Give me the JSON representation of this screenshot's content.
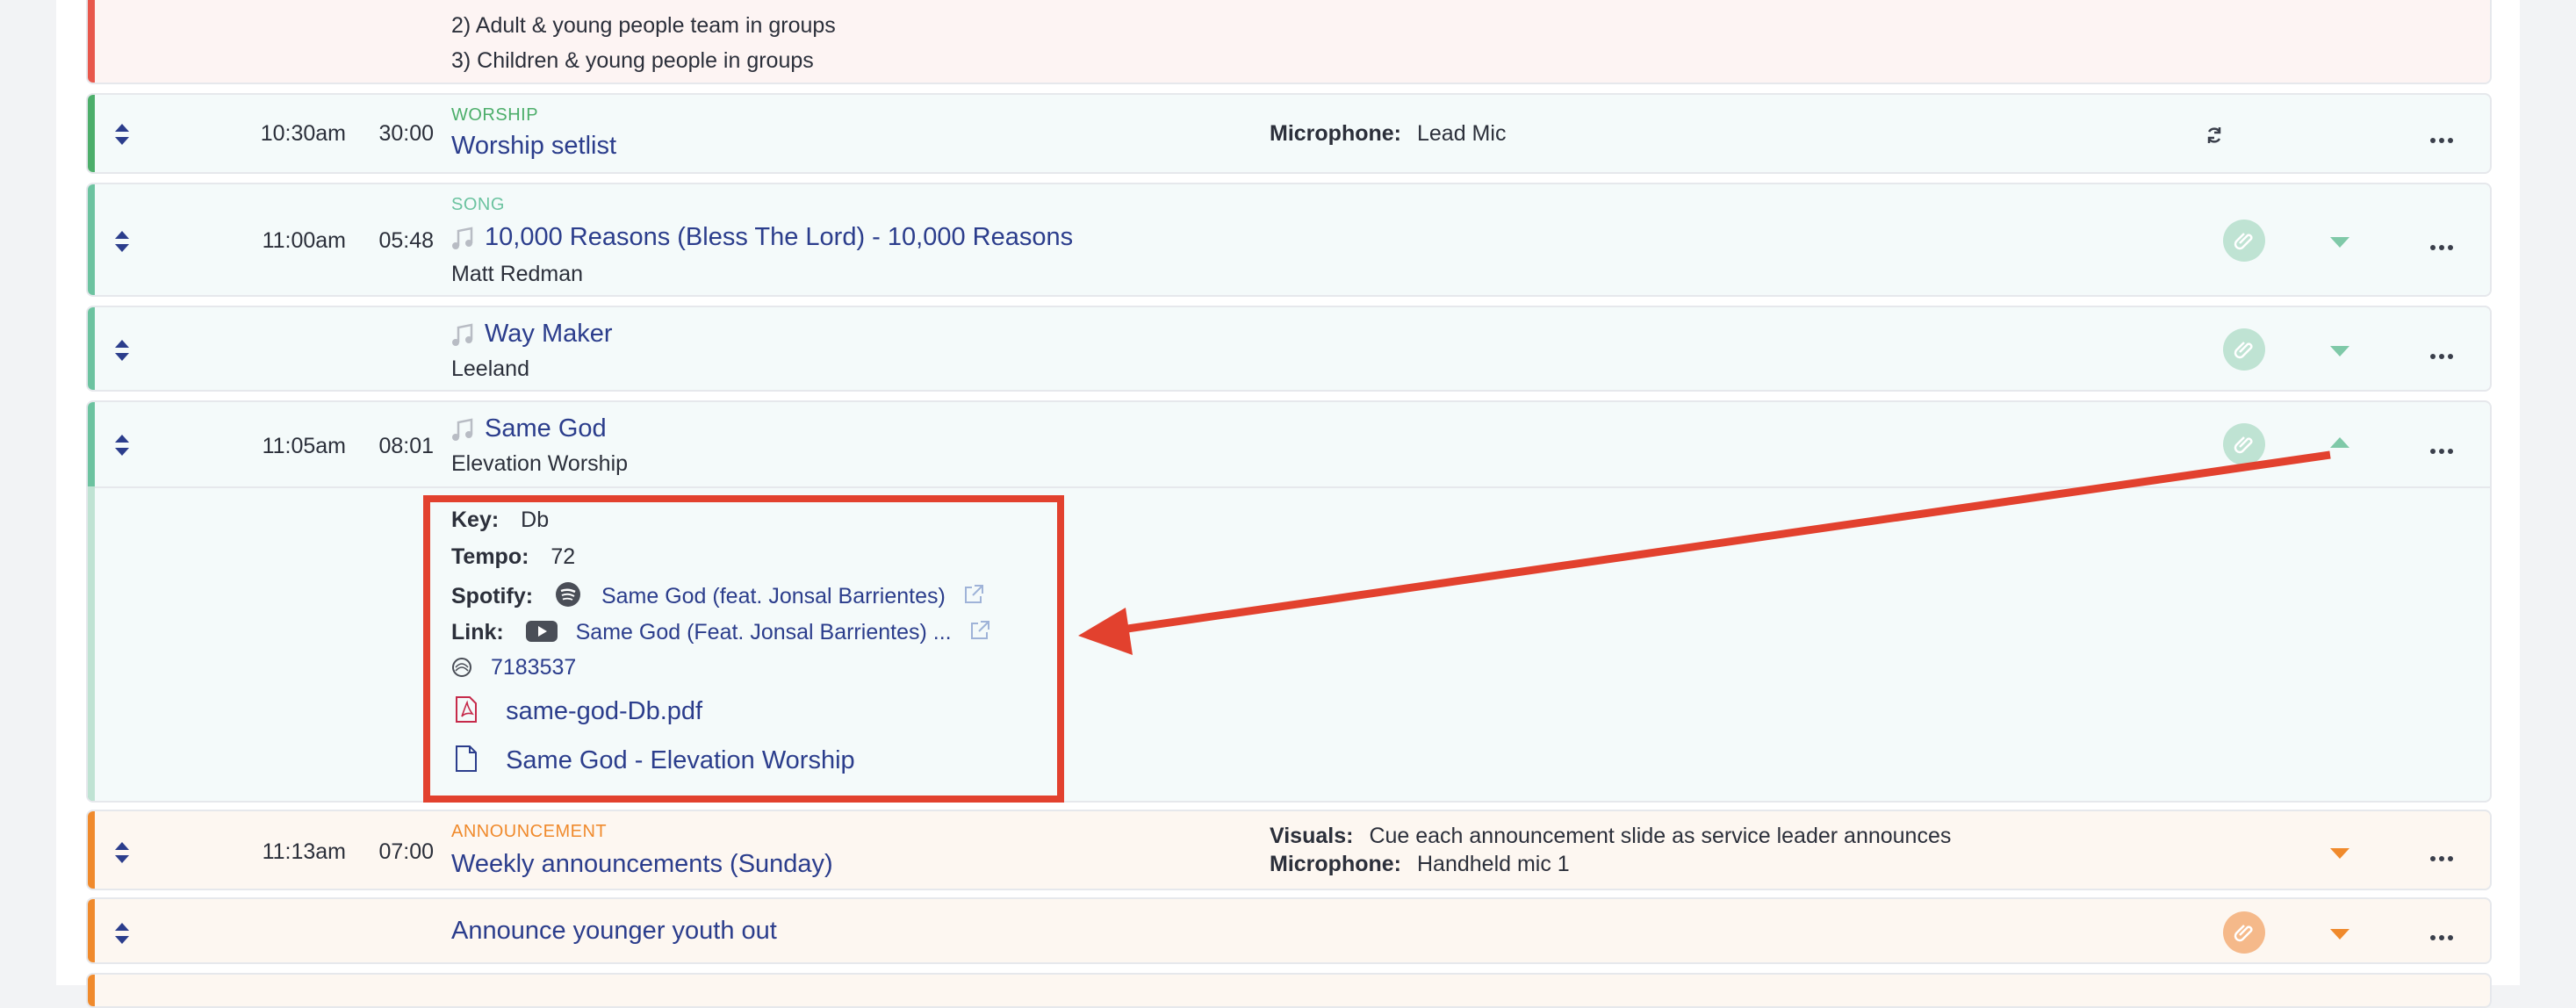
{
  "top_card": {
    "lines": [
      "2) Adult & young people team in groups",
      "3) Children & young people in groups"
    ]
  },
  "rows": {
    "worship": {
      "time": "10:30am",
      "duration": "30:00",
      "category": "WORSHIP",
      "title": "Worship setlist",
      "meta_label": "Microphone:",
      "meta_value": "Lead Mic"
    },
    "song1": {
      "time": "11:00am",
      "duration": "05:48",
      "category": "SONG",
      "title": "10,000 Reasons (Bless The Lord) - 10,000 Reasons",
      "artist": "Matt Redman"
    },
    "song2": {
      "title": "Way Maker",
      "artist": "Leeland"
    },
    "song3": {
      "time": "11:05am",
      "duration": "08:01",
      "title": "Same God",
      "artist": "Elevation Worship"
    },
    "details": {
      "key_label": "Key:",
      "key_value": "Db",
      "tempo_label": "Tempo:",
      "tempo_value": "72",
      "spotify_label": "Spotify:",
      "spotify_value": "Same God (feat. Jonsal Barrientes)",
      "link_label": "Link:",
      "link_value": "Same God (Feat. Jonsal Barrientes) ...",
      "ccli": "7183537",
      "file_pdf": "same-god-Db.pdf",
      "file_doc": "Same God - Elevation Worship"
    },
    "announcement": {
      "time": "11:13am",
      "duration": "07:00",
      "category": "ANNOUNCEMENT",
      "title": "Weekly announcements (Sunday)",
      "visuals_label": "Visuals:",
      "visuals_value": "Cue each announcement slide as service leader announces",
      "mic_label": "Microphone:",
      "mic_value": "Handheld mic 1"
    },
    "youth": {
      "title": "Announce younger youth out"
    }
  },
  "colors": {
    "red": "#e8574b",
    "green": "#4cae6a",
    "teal": "#6cc3a0",
    "orange": "#f08a2c",
    "link": "#2b3d8c",
    "annotation": "#e2412e"
  },
  "icons": [
    "drag-handle-icon",
    "sync-icon",
    "paperclip-icon",
    "chevron-down-icon",
    "chevron-up-icon",
    "more-icon",
    "music-note-icon",
    "spotify-icon",
    "youtube-icon",
    "external-link-icon",
    "ccli-icon",
    "pdf-icon",
    "document-icon"
  ]
}
